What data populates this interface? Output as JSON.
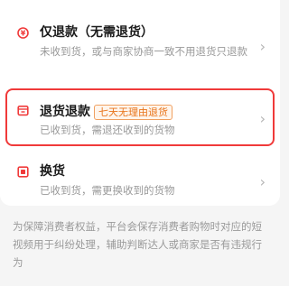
{
  "options": [
    {
      "title": "仅退款（无需退货）",
      "desc": "未收到货，或与商家协商一致不用退货只退款",
      "icon": "refund-coin-icon"
    },
    {
      "title": "退货退款",
      "tag": "七天无理由退货",
      "desc": "已收到货，需退还收到的货物",
      "icon": "return-box-icon",
      "selected": true
    },
    {
      "title": "换货",
      "desc": "已收到货，需更换收到的货物",
      "icon": "exchange-icon"
    }
  ],
  "chevron": "›",
  "footer_note": "为保障消费者权益，平台会保存消费者购物时对应的短视频用于纠纷处理，辅助判断达人或商家是否有违规行为",
  "colors": {
    "accent": "#f03a3a",
    "tag_text": "#e8741a",
    "tag_bg": "#fff5ec"
  }
}
